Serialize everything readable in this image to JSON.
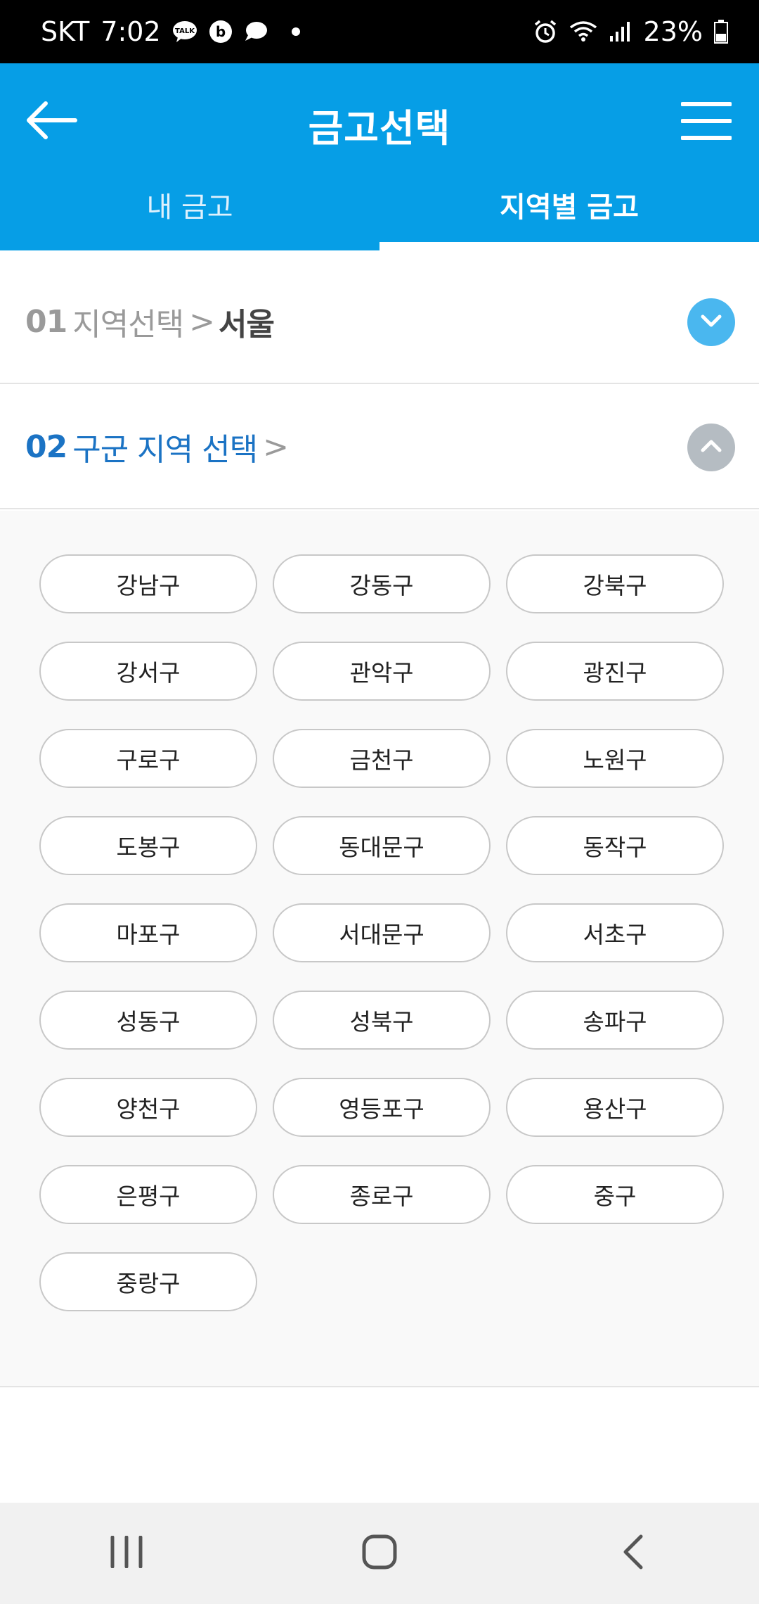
{
  "status_bar": {
    "carrier": "SKT",
    "time": "7:02",
    "battery": "23%",
    "icons": [
      "talk-icon",
      "b-icon",
      "chat-icon",
      "alarm-icon",
      "wifi-icon",
      "signal-icon",
      "battery-icon"
    ]
  },
  "header": {
    "title": "금고선택",
    "back_icon": "arrow-left-icon",
    "menu_icon": "hamburger-menu-icon",
    "tabs": [
      {
        "label": "내 금고",
        "active": false
      },
      {
        "label": "지역별 금고",
        "active": true
      }
    ]
  },
  "step1": {
    "num": "01",
    "label": "지역선택",
    "separator": ">",
    "value": "서울",
    "toggle_icon": "chevron-down-icon"
  },
  "step2": {
    "num": "02",
    "label": "구군 지역 선택",
    "separator": ">",
    "toggle_icon": "chevron-up-icon"
  },
  "districts": [
    "강남구",
    "강동구",
    "강북구",
    "강서구",
    "관악구",
    "광진구",
    "구로구",
    "금천구",
    "노원구",
    "도봉구",
    "동대문구",
    "동작구",
    "마포구",
    "서대문구",
    "서초구",
    "성동구",
    "성북구",
    "송파구",
    "양천구",
    "영등포구",
    "용산구",
    "은평구",
    "종로구",
    "중구",
    "중랑구"
  ],
  "colors": {
    "primary": "#069ee6",
    "step_active": "#1b73c4",
    "toggle_down": "#4ab7ef",
    "toggle_up": "#b5bcc2"
  },
  "navbar": {
    "icons": [
      "recent-apps-icon",
      "home-icon",
      "back-nav-icon"
    ]
  }
}
